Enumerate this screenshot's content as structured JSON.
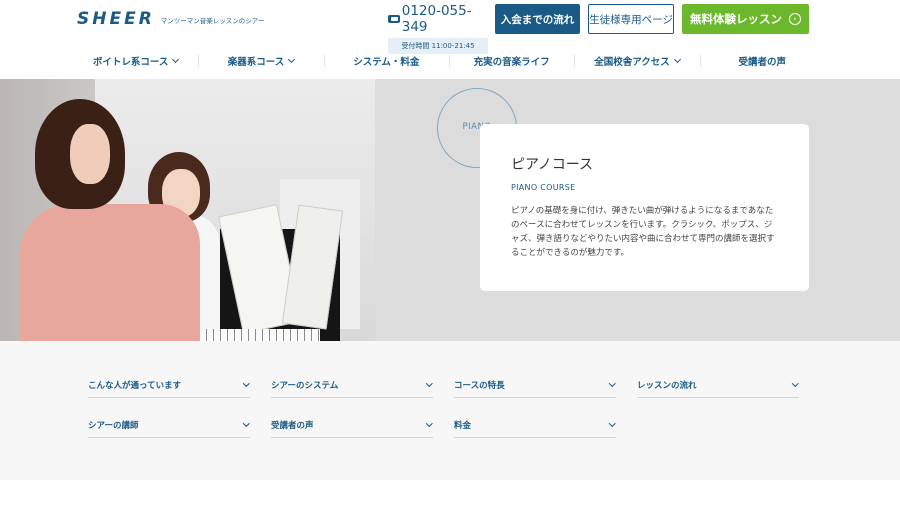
{
  "header": {
    "logo_text": "SHEER",
    "logo_tagline": "マンツーマン音楽レッスンのシアー",
    "phone_number": "0120-055-349",
    "phone_hours": "受付時間 11:00-21:45",
    "btn_flow": "入会までの流れ",
    "btn_student": "生徒様専用ページ",
    "btn_trial": "無料体験レッスン"
  },
  "nav": {
    "items": [
      {
        "label": "ボイトレ系コース",
        "dropdown": true
      },
      {
        "label": "楽器系コース",
        "dropdown": true
      },
      {
        "label": "システム・料金",
        "dropdown": false
      },
      {
        "label": "充実の音楽ライフ",
        "dropdown": false
      },
      {
        "label": "全国校舎アクセス",
        "dropdown": true
      },
      {
        "label": "受講者の声",
        "dropdown": false
      }
    ]
  },
  "hero": {
    "deco_label": "PIANO",
    "title": "ピアノコース",
    "subtitle": "PIANO COURSE",
    "description": "ピアノの基礎を身に付け、弾きたい曲が弾けるようになるまであなたのペースに合わせてレッスンを行います。クラシック、ポップス、ジャズ、弾き語りなどやりたい内容や曲に合わせて専門の講師を選択することができるのが魅力です。"
  },
  "subnav": {
    "items": [
      {
        "label": "こんな人が通っています"
      },
      {
        "label": "シアーのシステム"
      },
      {
        "label": "コースの特長"
      },
      {
        "label": "レッスンの流れ"
      },
      {
        "label": "シアーの講師"
      },
      {
        "label": "受講者の声"
      },
      {
        "label": "料金"
      }
    ]
  },
  "colors": {
    "brand": "#1a5a86",
    "trial_green": "#6cb82c"
  }
}
